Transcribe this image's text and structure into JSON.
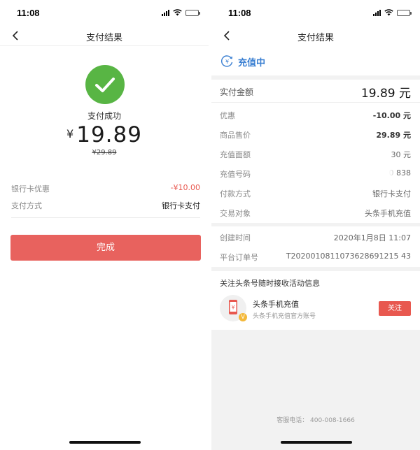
{
  "left": {
    "status_time": "11:08",
    "nav_title": "支付结果",
    "success_text": "支付成功",
    "currency": "¥",
    "amount": "19.89",
    "original_price": "¥29.89",
    "details": [
      {
        "label": "银行卡优惠",
        "value": "-¥10.00"
      },
      {
        "label": "支付方式",
        "value": "银行卡支付"
      }
    ],
    "done_button": "完成"
  },
  "right": {
    "status_time": "11:08",
    "nav_title": "支付结果",
    "status_label": "充值中",
    "pay_label": "实付金额",
    "pay_value": "19.89 元",
    "rows": [
      {
        "label": "优惠",
        "value": "-10.00 元"
      },
      {
        "label": "商品售价",
        "value": "29.89 元"
      },
      {
        "label": "充值面额",
        "value": "30 元"
      },
      {
        "label": "充值号码",
        "value": "180          838"
      },
      {
        "label": "付款方式",
        "value": "银行卡支付"
      },
      {
        "label": "交易对象",
        "value": "头条手机充值"
      }
    ],
    "order": [
      {
        "label": "创建时间",
        "value": "2020年1月8日 11:07"
      },
      {
        "label": "平台订单号",
        "value": "T2020010811073628691215 43"
      }
    ],
    "follow": {
      "title": "关注头条号随时接收活动信息",
      "name": "头条手机充值",
      "subtitle": "头条手机充值官方账号",
      "button": "关注",
      "badge": "V"
    },
    "service": "客服电话： 400-008-1666"
  },
  "colors": {
    "accent_red": "#e8625e",
    "success_green": "#58b544",
    "link_blue": "#3a7fd2"
  },
  "icons": [
    "back-arrow-icon",
    "checkmark-icon",
    "yuan-refresh-icon",
    "phone-recharge-icon",
    "verified-badge-icon"
  ]
}
